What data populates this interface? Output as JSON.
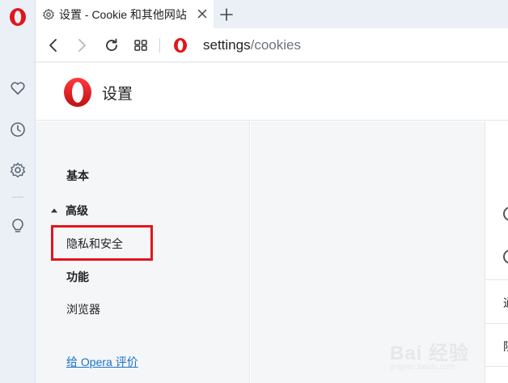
{
  "browser": {
    "tab": {
      "title": "设置 - Cookie 和其他网站"
    },
    "address": {
      "host": "settings",
      "path": "/cookies"
    }
  },
  "rail": {
    "icons": [
      "opera-logo-icon",
      "heart-icon",
      "history-clock-icon",
      "settings-gear-icon",
      "lightbulb-icon"
    ]
  },
  "header": {
    "title": "设置"
  },
  "nav": {
    "basic": "基本",
    "advanced": "高级",
    "privacy": "隐私和安全",
    "features": "功能",
    "browser": "浏览器",
    "rate": "给 Opera 评价"
  },
  "content": {
    "cut_row_1": "通",
    "cut_row_2": "阻"
  },
  "watermark": {
    "text": "Bai 经验",
    "sub": "jingyan.baidu.com"
  },
  "colors": {
    "opera_red": "#e0161c",
    "highlight_box": "#e0161c",
    "link": "#1a73c8",
    "rail_bg": "#eaf0f6",
    "nav_bg": "#f5f6f8"
  }
}
